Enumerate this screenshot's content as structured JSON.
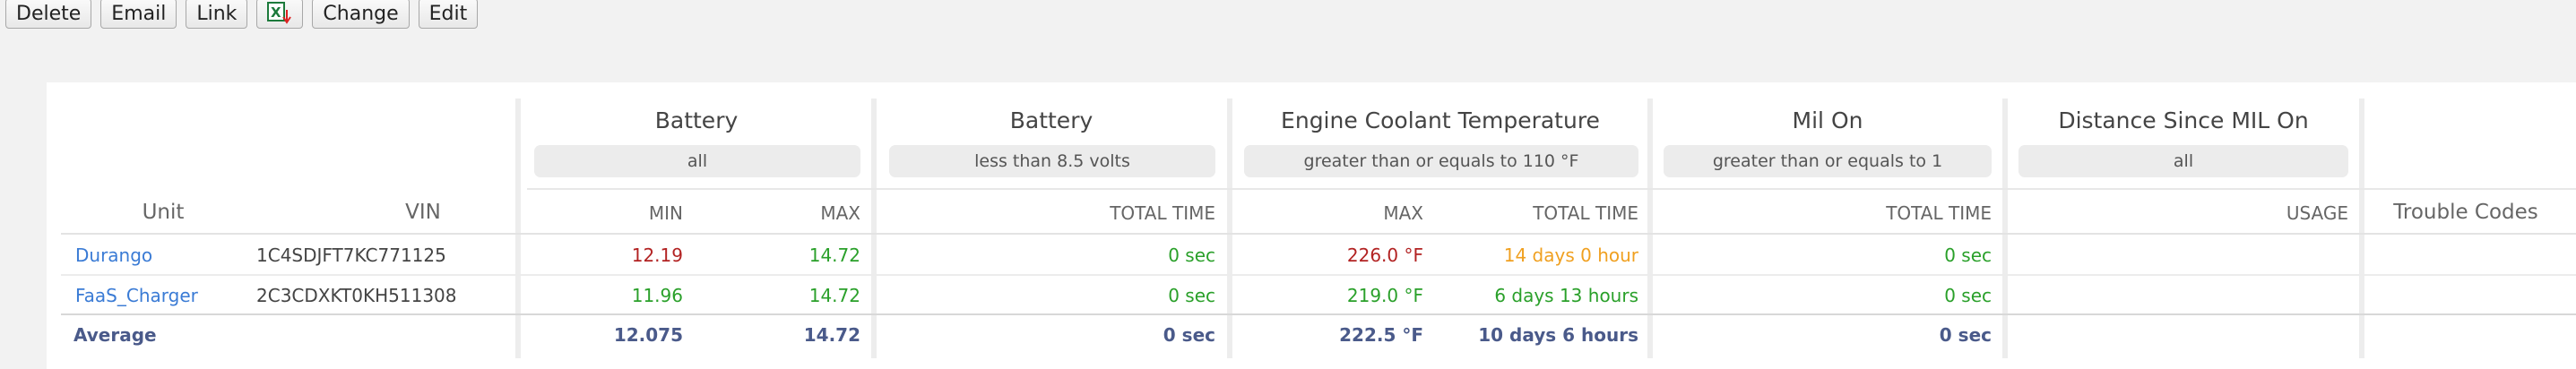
{
  "toolbar": {
    "delete_label": "Delete",
    "email_label": "Email",
    "link_label": "Link",
    "excel_icon": "excel-export-icon",
    "change_label": "Change",
    "edit_label": "Edit"
  },
  "table": {
    "unit_header": "Unit",
    "vin_header": "VIN",
    "groups": [
      {
        "title": "Battery",
        "filter": "all",
        "cols": [
          "MIN",
          "MAX"
        ]
      },
      {
        "title": "Battery",
        "filter": "less than 8.5 volts",
        "cols": [
          "TOTAL TIME"
        ]
      },
      {
        "title": "Engine Coolant Temperature",
        "filter": "greater than or equals to 110 °F",
        "cols": [
          "MAX",
          "TOTAL TIME"
        ]
      },
      {
        "title": "Mil On",
        "filter": "greater than or equals to 1",
        "cols": [
          "TOTAL TIME"
        ]
      },
      {
        "title": "Distance Since MIL On",
        "filter": "all",
        "cols": [
          "USAGE"
        ]
      }
    ],
    "trouble_codes_header": "Trouble Codes",
    "rows": [
      {
        "unit": "Durango",
        "vin": "1C4SDJFT7KC771125",
        "batt_min": "12.19",
        "batt_max": "14.72",
        "batt_low_time": "0 sec",
        "coolant_max": "226.0 °F",
        "coolant_time": "14 days 0 hour",
        "mil_time": "0 sec",
        "distance_usage": "",
        "trouble_codes": ""
      },
      {
        "unit": "FaaS_Charger",
        "vin": "2C3CDXKT0KH511308",
        "batt_min": "11.96",
        "batt_max": "14.72",
        "batt_low_time": "0 sec",
        "coolant_max": "219.0 °F",
        "coolant_time": "6 days 13 hours",
        "mil_time": "0 sec",
        "distance_usage": "",
        "trouble_codes": ""
      }
    ],
    "average": {
      "label": "Average",
      "batt_min": "12.075",
      "batt_max": "14.72",
      "batt_low_time": "0 sec",
      "coolant_max": "222.5 °F",
      "coolant_time": "10 days 6 hours",
      "mil_time": "0 sec"
    },
    "colors": {
      "link": "#3a7bd5",
      "red": "#b22222",
      "green": "#2aa02a",
      "orange": "#f0a020",
      "average": "#4a5a8a"
    }
  }
}
